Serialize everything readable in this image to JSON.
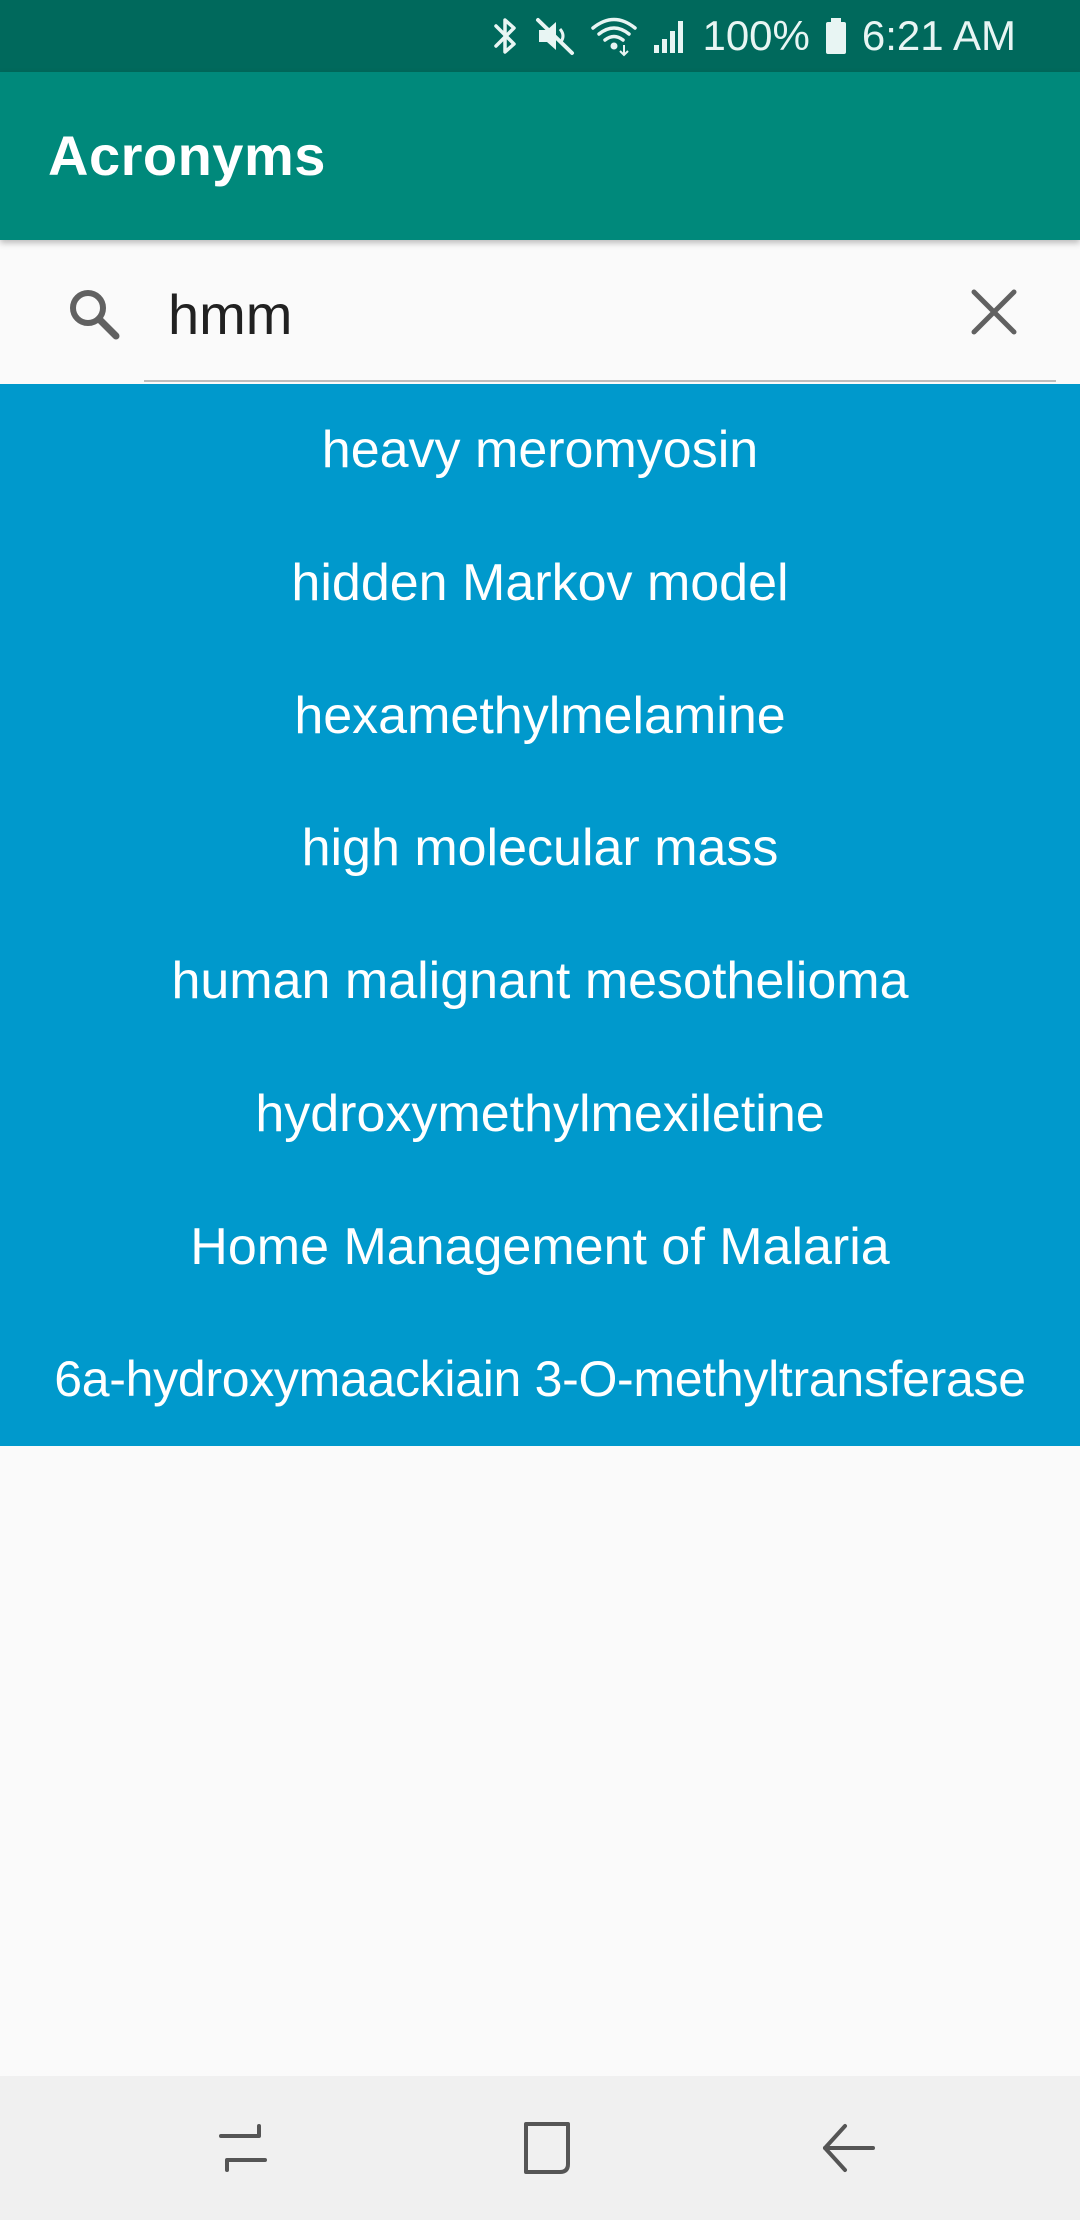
{
  "status_bar": {
    "battery_text": "100%",
    "time": "6:21 AM",
    "icons": [
      "bluetooth-icon",
      "mute-icon",
      "wifi-icon",
      "signal-icon",
      "battery-icon"
    ]
  },
  "app_bar": {
    "title": "Acronyms"
  },
  "search": {
    "value": "hmm",
    "icon": "search-icon",
    "clear_icon": "close-icon"
  },
  "results": [
    "heavy meromyosin",
    "hidden Markov model",
    "hexamethylmelamine",
    "high molecular mass",
    "human malignant mesothelioma",
    "hydroxymethylmexiletine",
    "Home Management of Malaria",
    "6a-hydroxymaackiain 3-O-methyltransferase"
  ],
  "colors": {
    "status_bar": "#00695c",
    "app_bar": "#00897b",
    "results_background": "#0099cc",
    "page_background": "#fafafa",
    "nav_bar": "#f0f0f0"
  },
  "nav_bar": {
    "icons": [
      "recents-icon",
      "home-icon",
      "back-icon"
    ]
  }
}
